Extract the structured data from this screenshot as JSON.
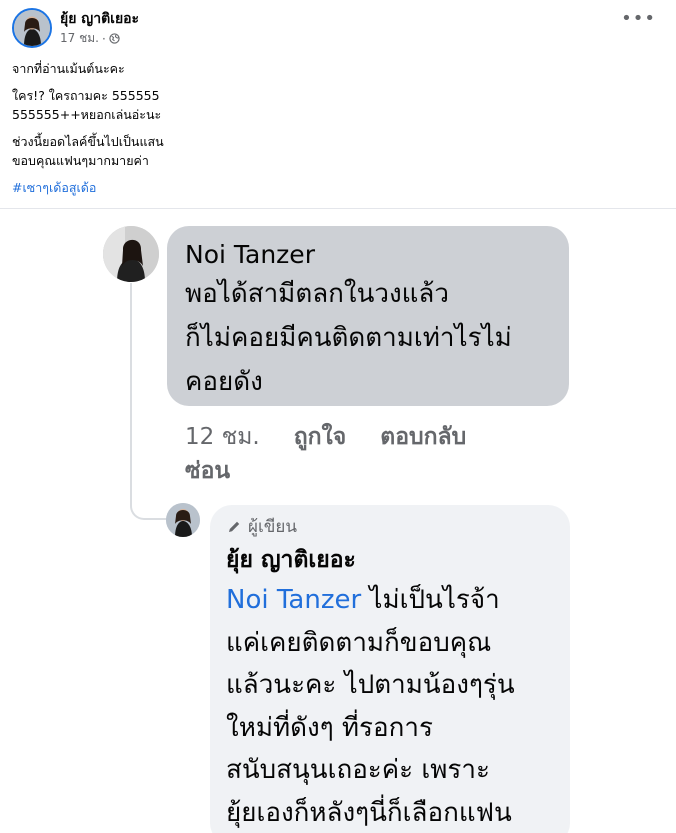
{
  "post": {
    "author": "ยุ้ย ญาติเยอะ",
    "time": "17 ชม.",
    "separator": "·",
    "text_lines": [
      "จากที่อ่านเม้นต์นะคะ",
      "ใคร!? ใครถามคะ 555555",
      "555555++หยอกเล่นอ่ะนะ",
      "ช่วงนี้ยอดไลค์ขึ้นไปเป็นแสน",
      "ขอบคุณแฟนๆมากมายค่า"
    ],
    "hashtag": "#เซาๆเด้อสูเด้อ",
    "more_label": "•••"
  },
  "comment1": {
    "name": "Noi Tanzer",
    "text_lines": [
      "พอได้สามีตลกในวงแล้ว",
      "ก็ไม่คอยมีคนติดตามเท่าไรไม่",
      "คอยดัง"
    ],
    "time": "12 ชม.",
    "like": "ถูกใจ",
    "reply": "ตอบกลับ",
    "hide": "ซ่อน"
  },
  "comment2": {
    "badge": "ผู้เขียน",
    "name": "ยุ้ย ญาติเยอะ",
    "mention": "Noi Tanzer",
    "first_line_rest": " ไม่เป็นไรจ้า",
    "text_lines": [
      "แค่เคยติดตามก็ขอบคุณ",
      "แล้วนะคะ ไปตามน้องๆรุ่น",
      "ใหม่ที่ดังๆ ที่รอการ",
      "สนับสนุนเถอะค่ะ เพราะ",
      "ยุ้ยเองก็หลังๆนี่ก็เลือกแฟน"
    ]
  },
  "colors": {
    "link": "#216fdb",
    "muted": "#65676b",
    "bubble_dark": "#cdd0d5",
    "bubble_light": "#f0f2f5"
  }
}
